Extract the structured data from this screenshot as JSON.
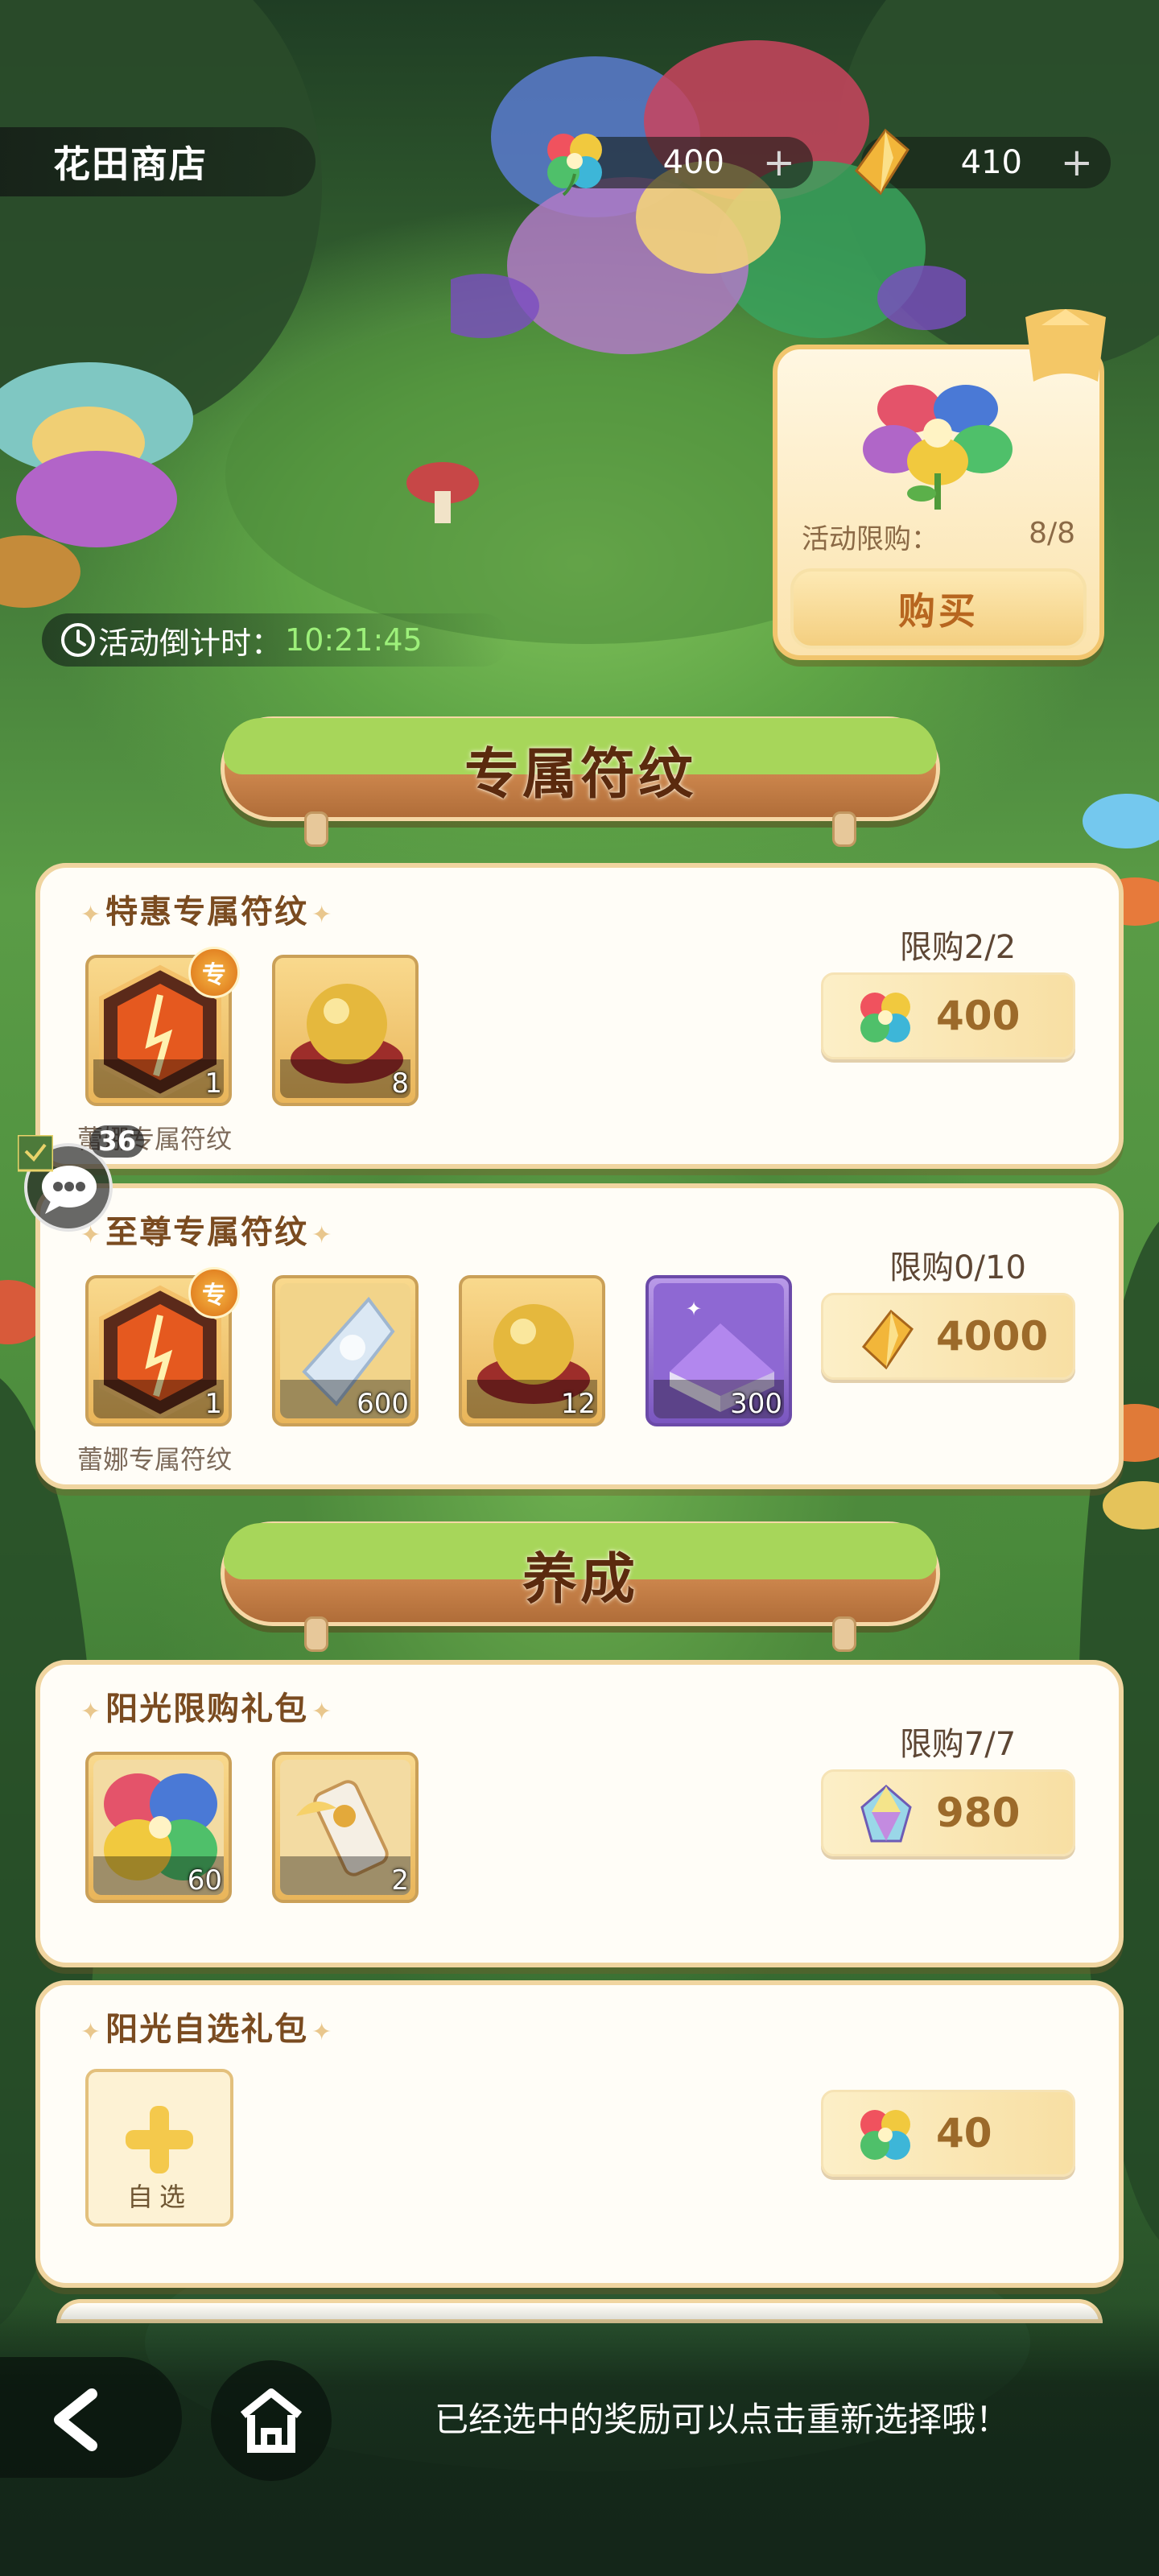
{
  "header": {
    "shop_title": "花田商店",
    "currency_flower": {
      "amount": "400",
      "plus": "+"
    },
    "currency_gem": {
      "amount": "410",
      "plus": "+"
    }
  },
  "promo": {
    "limit_label": "活动限购：",
    "limit_value": "8/8",
    "buy_label": "购买"
  },
  "countdown": {
    "label": "活动倒计时：",
    "time": "10:21:45"
  },
  "sections": {
    "exclusive_title": "专属符纹",
    "growth_title": "养成"
  },
  "panels": {
    "discount_rune": {
      "title": "特惠专属符纹",
      "limit": "限购2/2",
      "price": "400",
      "items": [
        {
          "count": "1",
          "badge": "专",
          "caption": "蕾娜专属符纹"
        },
        {
          "count": "8"
        }
      ]
    },
    "supreme_rune": {
      "title": "至尊专属符纹",
      "limit": "限购0/10",
      "price": "4000",
      "items": [
        {
          "count": "1",
          "badge": "专",
          "caption": "蕾娜专属符纹"
        },
        {
          "count": "600"
        },
        {
          "count": "12"
        },
        {
          "count": "300"
        }
      ]
    },
    "sunshine_limited": {
      "title": "阳光限购礼包",
      "limit": "限购7/7",
      "price": "980",
      "items": [
        {
          "count": "60"
        },
        {
          "count": "2"
        }
      ]
    },
    "sunshine_select": {
      "title": "阳光自选礼包",
      "select_label": "自选",
      "price": "40"
    }
  },
  "chat": {
    "count": "36"
  },
  "footer": {
    "hint": "已经选中的奖励可以点击重新选择哦！"
  },
  "colors": {
    "accent_brown": "#7a4b20",
    "price_text": "#9c6a2a",
    "countdown_green": "#9df07a",
    "panel_border": "#f0d5a0"
  }
}
